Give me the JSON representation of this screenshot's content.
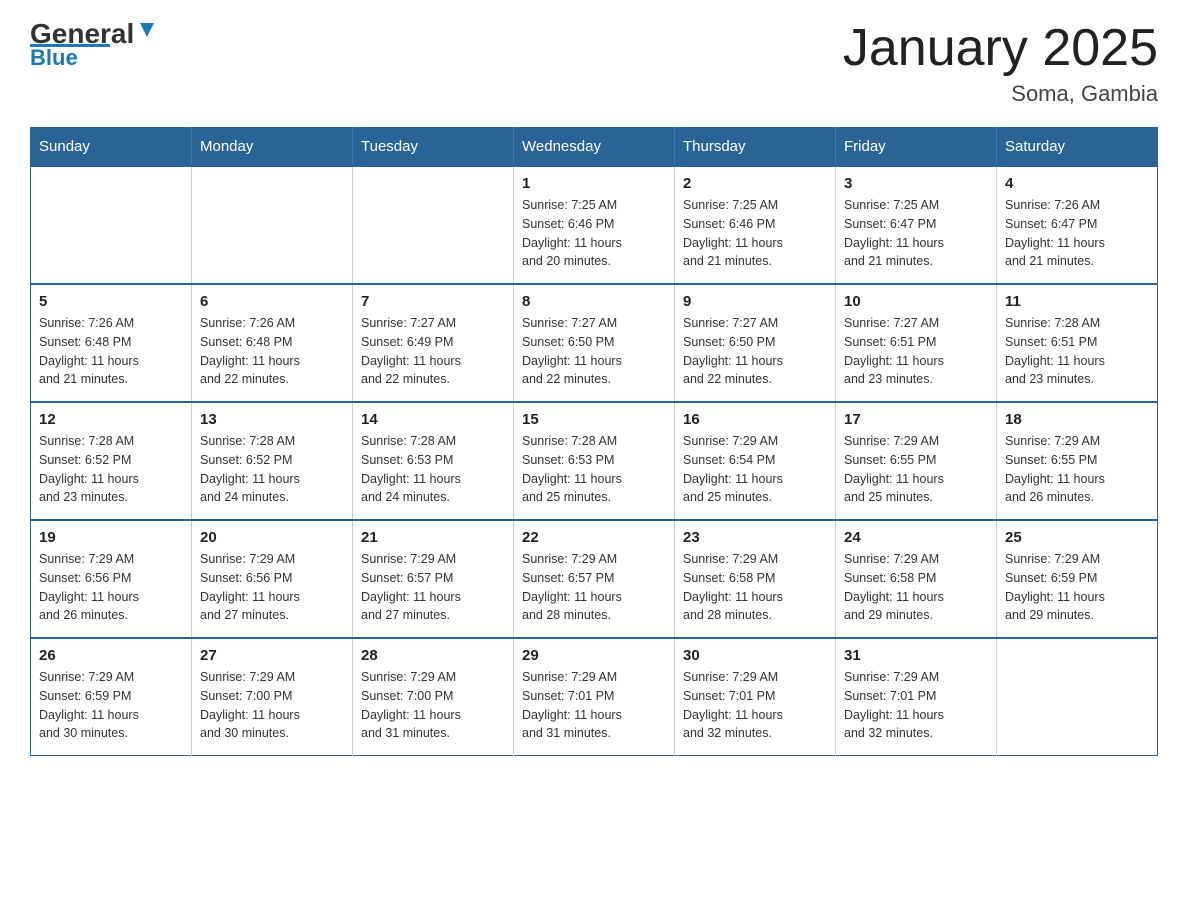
{
  "header": {
    "logo_text_black": "General",
    "logo_text_blue": "Blue",
    "title": "January 2025",
    "subtitle": "Soma, Gambia"
  },
  "calendar": {
    "days_of_week": [
      "Sunday",
      "Monday",
      "Tuesday",
      "Wednesday",
      "Thursday",
      "Friday",
      "Saturday"
    ],
    "weeks": [
      [
        {
          "day": "",
          "info": ""
        },
        {
          "day": "",
          "info": ""
        },
        {
          "day": "",
          "info": ""
        },
        {
          "day": "1",
          "info": "Sunrise: 7:25 AM\nSunset: 6:46 PM\nDaylight: 11 hours\nand 20 minutes."
        },
        {
          "day": "2",
          "info": "Sunrise: 7:25 AM\nSunset: 6:46 PM\nDaylight: 11 hours\nand 21 minutes."
        },
        {
          "day": "3",
          "info": "Sunrise: 7:25 AM\nSunset: 6:47 PM\nDaylight: 11 hours\nand 21 minutes."
        },
        {
          "day": "4",
          "info": "Sunrise: 7:26 AM\nSunset: 6:47 PM\nDaylight: 11 hours\nand 21 minutes."
        }
      ],
      [
        {
          "day": "5",
          "info": "Sunrise: 7:26 AM\nSunset: 6:48 PM\nDaylight: 11 hours\nand 21 minutes."
        },
        {
          "day": "6",
          "info": "Sunrise: 7:26 AM\nSunset: 6:48 PM\nDaylight: 11 hours\nand 22 minutes."
        },
        {
          "day": "7",
          "info": "Sunrise: 7:27 AM\nSunset: 6:49 PM\nDaylight: 11 hours\nand 22 minutes."
        },
        {
          "day": "8",
          "info": "Sunrise: 7:27 AM\nSunset: 6:50 PM\nDaylight: 11 hours\nand 22 minutes."
        },
        {
          "day": "9",
          "info": "Sunrise: 7:27 AM\nSunset: 6:50 PM\nDaylight: 11 hours\nand 22 minutes."
        },
        {
          "day": "10",
          "info": "Sunrise: 7:27 AM\nSunset: 6:51 PM\nDaylight: 11 hours\nand 23 minutes."
        },
        {
          "day": "11",
          "info": "Sunrise: 7:28 AM\nSunset: 6:51 PM\nDaylight: 11 hours\nand 23 minutes."
        }
      ],
      [
        {
          "day": "12",
          "info": "Sunrise: 7:28 AM\nSunset: 6:52 PM\nDaylight: 11 hours\nand 23 minutes."
        },
        {
          "day": "13",
          "info": "Sunrise: 7:28 AM\nSunset: 6:52 PM\nDaylight: 11 hours\nand 24 minutes."
        },
        {
          "day": "14",
          "info": "Sunrise: 7:28 AM\nSunset: 6:53 PM\nDaylight: 11 hours\nand 24 minutes."
        },
        {
          "day": "15",
          "info": "Sunrise: 7:28 AM\nSunset: 6:53 PM\nDaylight: 11 hours\nand 25 minutes."
        },
        {
          "day": "16",
          "info": "Sunrise: 7:29 AM\nSunset: 6:54 PM\nDaylight: 11 hours\nand 25 minutes."
        },
        {
          "day": "17",
          "info": "Sunrise: 7:29 AM\nSunset: 6:55 PM\nDaylight: 11 hours\nand 25 minutes."
        },
        {
          "day": "18",
          "info": "Sunrise: 7:29 AM\nSunset: 6:55 PM\nDaylight: 11 hours\nand 26 minutes."
        }
      ],
      [
        {
          "day": "19",
          "info": "Sunrise: 7:29 AM\nSunset: 6:56 PM\nDaylight: 11 hours\nand 26 minutes."
        },
        {
          "day": "20",
          "info": "Sunrise: 7:29 AM\nSunset: 6:56 PM\nDaylight: 11 hours\nand 27 minutes."
        },
        {
          "day": "21",
          "info": "Sunrise: 7:29 AM\nSunset: 6:57 PM\nDaylight: 11 hours\nand 27 minutes."
        },
        {
          "day": "22",
          "info": "Sunrise: 7:29 AM\nSunset: 6:57 PM\nDaylight: 11 hours\nand 28 minutes."
        },
        {
          "day": "23",
          "info": "Sunrise: 7:29 AM\nSunset: 6:58 PM\nDaylight: 11 hours\nand 28 minutes."
        },
        {
          "day": "24",
          "info": "Sunrise: 7:29 AM\nSunset: 6:58 PM\nDaylight: 11 hours\nand 29 minutes."
        },
        {
          "day": "25",
          "info": "Sunrise: 7:29 AM\nSunset: 6:59 PM\nDaylight: 11 hours\nand 29 minutes."
        }
      ],
      [
        {
          "day": "26",
          "info": "Sunrise: 7:29 AM\nSunset: 6:59 PM\nDaylight: 11 hours\nand 30 minutes."
        },
        {
          "day": "27",
          "info": "Sunrise: 7:29 AM\nSunset: 7:00 PM\nDaylight: 11 hours\nand 30 minutes."
        },
        {
          "day": "28",
          "info": "Sunrise: 7:29 AM\nSunset: 7:00 PM\nDaylight: 11 hours\nand 31 minutes."
        },
        {
          "day": "29",
          "info": "Sunrise: 7:29 AM\nSunset: 7:01 PM\nDaylight: 11 hours\nand 31 minutes."
        },
        {
          "day": "30",
          "info": "Sunrise: 7:29 AM\nSunset: 7:01 PM\nDaylight: 11 hours\nand 32 minutes."
        },
        {
          "day": "31",
          "info": "Sunrise: 7:29 AM\nSunset: 7:01 PM\nDaylight: 11 hours\nand 32 minutes."
        },
        {
          "day": "",
          "info": ""
        }
      ]
    ]
  }
}
